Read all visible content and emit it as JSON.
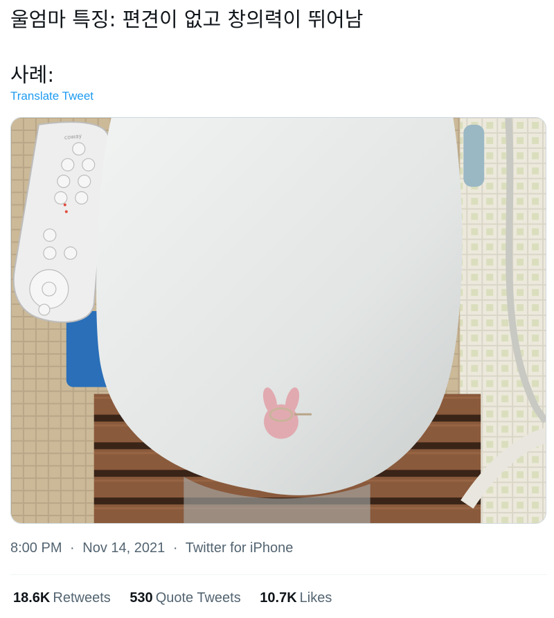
{
  "tweet": {
    "text_lines": [
      "울엄마 특징: 편견이 없고 창의력이 뛰어남",
      "사례:"
    ],
    "translate_label": "Translate Tweet"
  },
  "media": {
    "remote_brand": "coway",
    "colors": {
      "seat": "#e6e9e8",
      "tile": "#cbb998",
      "wood": "#8a5a3c",
      "ring_holder": "#e1aab0",
      "bucket": "#2a6fb8"
    }
  },
  "meta": {
    "time": "8:00 PM",
    "separator": "·",
    "date": "Nov 14, 2021",
    "source": "Twitter for iPhone"
  },
  "stats": {
    "retweets": {
      "count": "18.6K",
      "label": "Retweets"
    },
    "quotes": {
      "count": "530",
      "label": "Quote Tweets"
    },
    "likes": {
      "count": "10.7K",
      "label": "Likes"
    }
  }
}
